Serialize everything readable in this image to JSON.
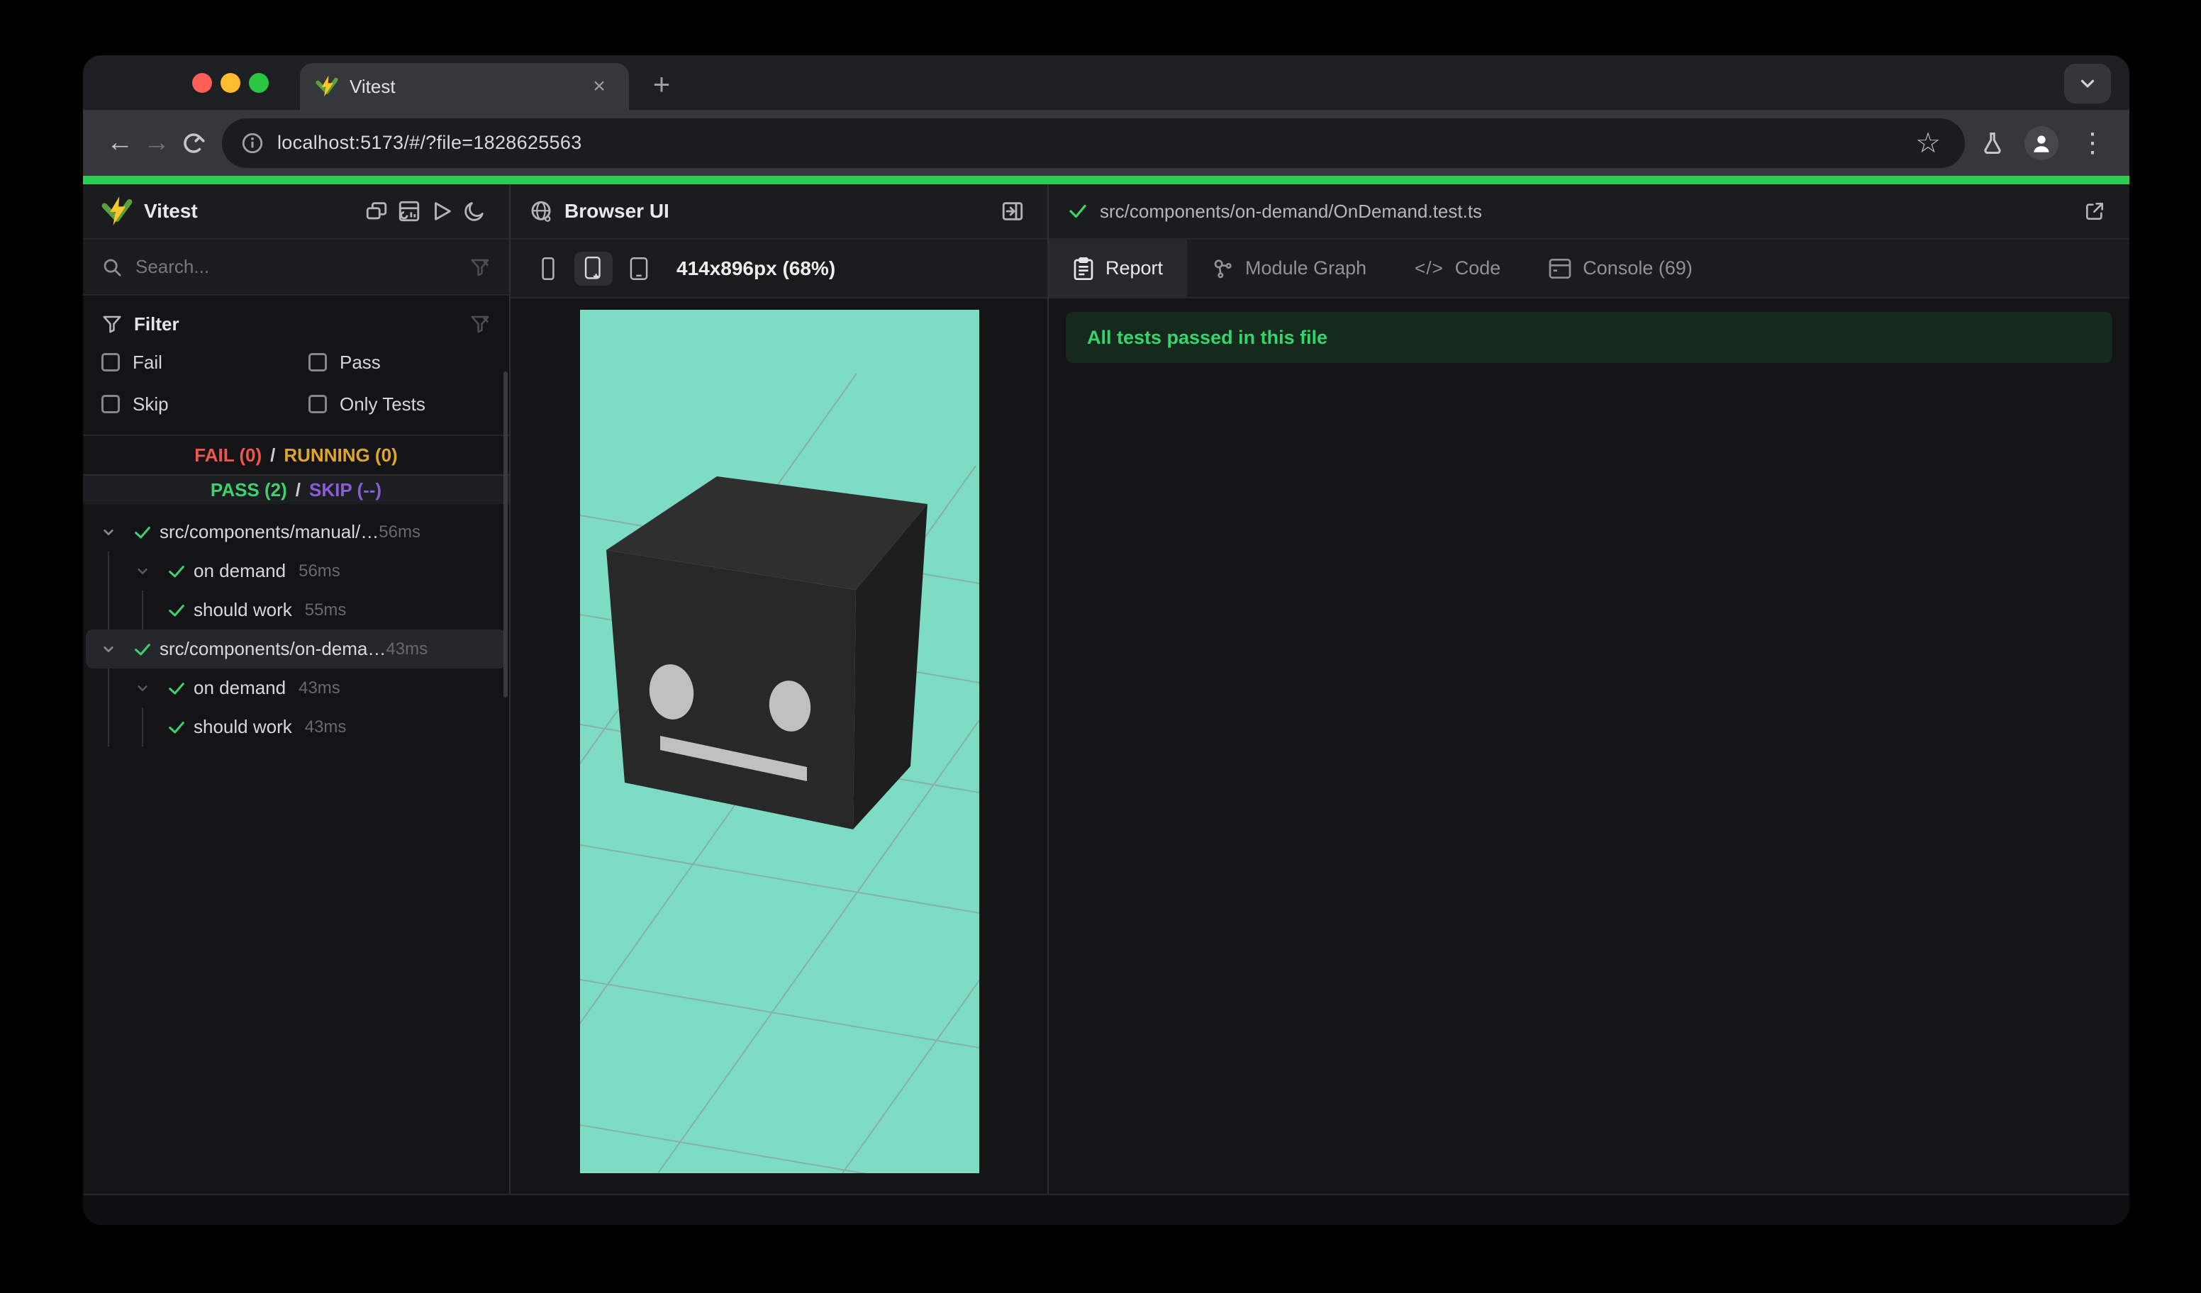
{
  "browser": {
    "tab_title": "Vitest",
    "url": "localhost:5173/#/?file=1828625563",
    "close_glyph": "×",
    "new_tab_glyph": "+",
    "back_glyph": "←",
    "forward_glyph": "→",
    "kebab_glyph": "⋮",
    "star_glyph": "☆"
  },
  "sidebar": {
    "title": "Vitest",
    "search": {
      "placeholder": "Search..."
    },
    "filter": {
      "title": "Filter",
      "options": [
        "Fail",
        "Pass",
        "Skip",
        "Only Tests"
      ]
    },
    "stats": {
      "fail": "FAIL (0)",
      "running": "RUNNING (0)",
      "pass": "PASS (2)",
      "skip": "SKIP (--)",
      "separator": "/"
    },
    "tree": [
      {
        "kind": "file",
        "label": "src/components/manual/…",
        "time": "56ms",
        "selected": false
      },
      {
        "kind": "suite",
        "label": "on demand",
        "time": "56ms",
        "selected": false
      },
      {
        "kind": "test",
        "label": "should work",
        "time": "55ms",
        "selected": false
      },
      {
        "kind": "file",
        "label": "src/components/on-dema…",
        "time": "43ms",
        "selected": true
      },
      {
        "kind": "suite",
        "label": "on demand",
        "time": "43ms",
        "selected": false
      },
      {
        "kind": "test",
        "label": "should work",
        "time": "43ms",
        "selected": false
      }
    ]
  },
  "middle": {
    "title": "Browser UI",
    "size_label": "414x896px (68%)"
  },
  "right": {
    "file_path": "src/components/on-demand/OnDemand.test.ts",
    "tabs": [
      {
        "label": "Report",
        "icon": "report",
        "active": true
      },
      {
        "label": "Module Graph",
        "icon": "module-graph",
        "active": false
      },
      {
        "label": "Code",
        "icon": "code",
        "active": false
      },
      {
        "label": "Console (69)",
        "icon": "console",
        "active": false
      }
    ],
    "banner": "All tests passed in this file"
  },
  "colors": {
    "accent_green": "#2ecc52",
    "pass_green": "#3ed16c",
    "fail_red": "#f0564f",
    "running_amber": "#dfa62b",
    "skip_purple": "#8a5cd8",
    "viewport_teal": "#7edcc4",
    "logo_yellow": "#fcc72b",
    "logo_green": "#5aa13c"
  }
}
